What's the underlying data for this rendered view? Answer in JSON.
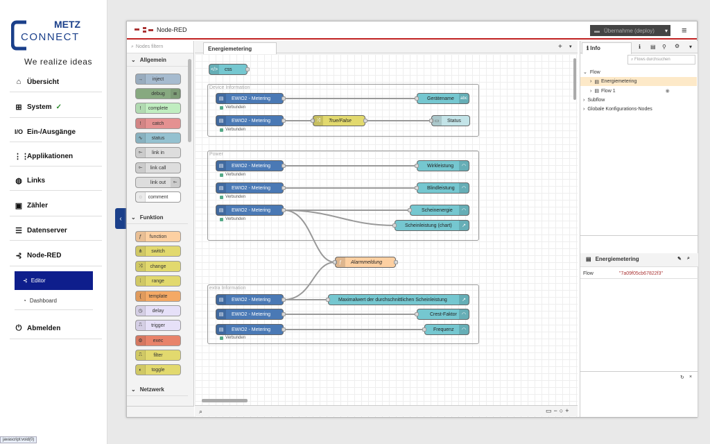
{
  "sidebar": {
    "brand_top": "METZ",
    "brand_bottom": "CONNECT",
    "slogan": "We realize ideas",
    "items": [
      {
        "label": "Übersicht",
        "icon": "home-icon"
      },
      {
        "label": "System",
        "icon": "router-icon"
      },
      {
        "label": "Ein-/Ausgänge",
        "icon": "io-icon"
      },
      {
        "label": "Applikationen",
        "icon": "grid-icon"
      },
      {
        "label": "Links",
        "icon": "globe-icon"
      },
      {
        "label": "Zähler",
        "icon": "meter-icon"
      },
      {
        "label": "Datenserver",
        "icon": "database-icon"
      },
      {
        "label": "Node-RED",
        "icon": "node-red-icon"
      },
      {
        "label": "Abmelden",
        "icon": "power-icon"
      }
    ],
    "io_prefix": "I/O",
    "check": "✓",
    "sub": [
      {
        "label": "Editor"
      },
      {
        "label": "Dashboard"
      }
    ]
  },
  "status_url": "javascript:void(0)",
  "nodered": {
    "title": "Node-RED",
    "deploy": "Übernahme (deploy)",
    "filter_placeholder": "Nodes filtern",
    "tab": "Energiemetering",
    "palette": {
      "categories": [
        "Allgemein",
        "Funktion",
        "Netzwerk"
      ],
      "general": [
        "inject",
        "debug",
        "complete",
        "catch",
        "status",
        "link in",
        "link call",
        "link out",
        "comment"
      ],
      "function": [
        "function",
        "switch",
        "change",
        "range",
        "template",
        "delay",
        "trigger",
        "exec",
        "filter",
        "toggle"
      ]
    },
    "groups": [
      "Device Information",
      "Power",
      "extra Information"
    ],
    "nodes": {
      "css": "css",
      "ewio": "EWIO2 - Metering",
      "geraet": "Gerätename",
      "tf": "True/False",
      "status": "Status",
      "wirk": "Wirkleistung",
      "blind": "Blindleistung",
      "schein": "Scheinenergie",
      "scheinchart": "Scheinleistung (chart)",
      "alarm": "Alarmmeldung",
      "max": "Maximalwert der durchschnittlichen Scheinleistung",
      "crest": "Crest-Faktor",
      "freq": "Frequenz"
    },
    "status_text": "Verbunden",
    "info": {
      "tab": "Info",
      "search": "Flows durchsuchen",
      "flow": "Flow",
      "energie": "Energiemetering",
      "flow1": "Flow 1",
      "subflow": "Subflow",
      "global": "Globale Konfigurations-Nodes",
      "panel_title": "Energiemetering",
      "prop_key": "Flow",
      "prop_value": "\"7a09f05cb67822f3\""
    }
  },
  "colors": {
    "accent": "#1a3f8a",
    "ewio": "#4a79b5",
    "dash": "#75c7d0",
    "func": "#fdd0a2",
    "red": "#c02020"
  }
}
